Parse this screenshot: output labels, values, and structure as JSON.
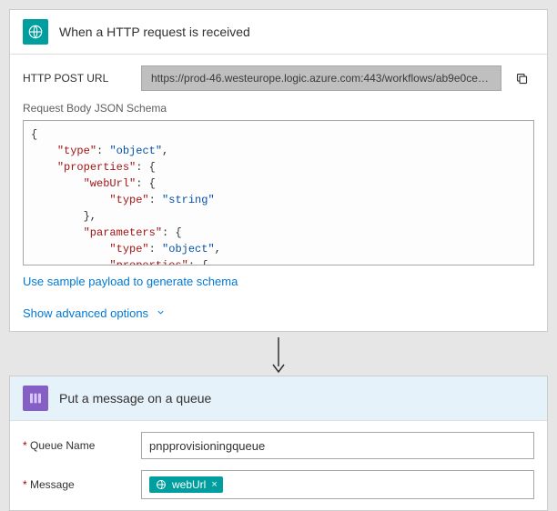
{
  "http_trigger": {
    "title": "When a HTTP request is received",
    "url_label": "HTTP POST URL",
    "url_value": "https://prod-46.westeurope.logic.azure.com:443/workflows/ab9e0ced...",
    "schema_label": "Request Body JSON Schema",
    "schema_lines": [
      {
        "indent": 0,
        "raw": "{"
      },
      {
        "indent": 1,
        "key": "type",
        "val": "object",
        "comma": true
      },
      {
        "indent": 1,
        "key": "properties",
        "open": true
      },
      {
        "indent": 2,
        "key": "webUrl",
        "open": true
      },
      {
        "indent": 3,
        "key": "type",
        "val": "string"
      },
      {
        "indent": 2,
        "close": true,
        "comma": true
      },
      {
        "indent": 2,
        "key": "parameters",
        "open": true
      },
      {
        "indent": 3,
        "key": "type",
        "val": "object",
        "comma": true
      },
      {
        "indent": 3,
        "key": "properties",
        "open": true
      }
    ],
    "sample_link": "Use sample payload to generate schema",
    "advanced_link": "Show advanced options"
  },
  "queue_action": {
    "title": "Put a message on a queue",
    "queue_label": "Queue Name",
    "queue_value": "pnpprovisioningqueue",
    "message_label": "Message",
    "token_label": "webUrl"
  }
}
